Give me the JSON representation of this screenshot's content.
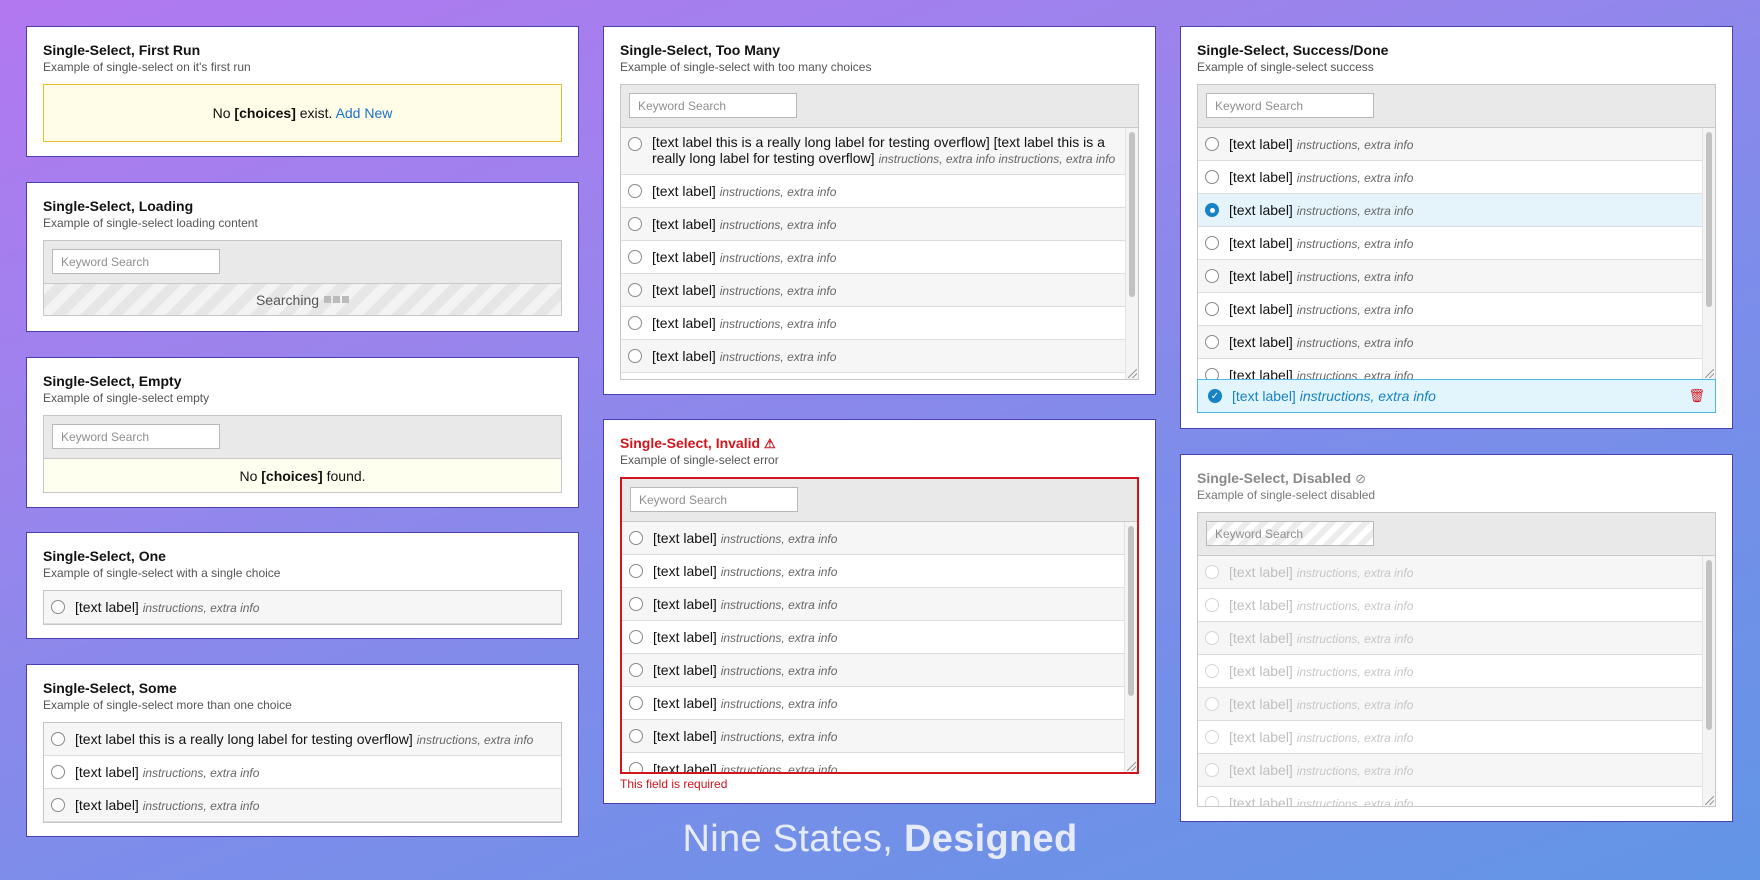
{
  "placeholder": "Keyword Search",
  "footer": {
    "light": "Nine States,",
    "bold": "Designed"
  },
  "first_run": {
    "title": "Single-Select, First Run",
    "subtitle": "Example of single-select on it's first run",
    "msg_pre": "No ",
    "msg_bold": "[choices]",
    "msg_post": " exist. ",
    "link": "Add New"
  },
  "loading": {
    "title": "Single-Select, Loading",
    "subtitle": "Example of single-select loading content",
    "status": "Searching"
  },
  "empty": {
    "title": "Single-Select, Empty",
    "subtitle": "Example of single-select empty",
    "msg_pre": "No ",
    "msg_bold": "[choices]",
    "msg_post": " found."
  },
  "one": {
    "title": "Single-Select, One",
    "subtitle": "Example of single-select with a single choice",
    "items": [
      {
        "label": "[text label]",
        "info": "instructions, extra info"
      }
    ]
  },
  "some": {
    "title": "Single-Select, Some",
    "subtitle": "Example of single-select more than one choice",
    "items": [
      {
        "label": "[text label this is a really long label for testing overflow]",
        "info": "instructions, extra info"
      },
      {
        "label": "[text label]",
        "info": "instructions, extra info"
      },
      {
        "label": "[text label]",
        "info": "instructions, extra info"
      }
    ]
  },
  "too_many": {
    "title": "Single-Select, Too Many",
    "subtitle": "Example of single-select with too many choices",
    "items": [
      {
        "label": "[text label this is a really long label for testing overflow] [text label this is a really long label for testing overflow]",
        "info": "instructions, extra info instructions, extra info"
      },
      {
        "label": "[text label]",
        "info": "instructions, extra info"
      },
      {
        "label": "[text label]",
        "info": "instructions, extra info"
      },
      {
        "label": "[text label]",
        "info": "instructions, extra info"
      },
      {
        "label": "[text label]",
        "info": "instructions, extra info"
      },
      {
        "label": "[text label]",
        "info": "instructions, extra info"
      },
      {
        "label": "[text label]",
        "info": "instructions, extra info"
      }
    ]
  },
  "invalid": {
    "title": "Single-Select, Invalid",
    "title_icon": "warning-icon",
    "subtitle": "Example of single-select error",
    "error": "This field is required",
    "items": [
      {
        "label": "[text label]",
        "info": "instructions, extra info"
      },
      {
        "label": "[text label]",
        "info": "instructions, extra info"
      },
      {
        "label": "[text label]",
        "info": "instructions, extra info"
      },
      {
        "label": "[text label]",
        "info": "instructions, extra info"
      },
      {
        "label": "[text label]",
        "info": "instructions, extra info"
      },
      {
        "label": "[text label]",
        "info": "instructions, extra info"
      },
      {
        "label": "[text label]",
        "info": "instructions, extra info"
      },
      {
        "label": "[text label]",
        "info": "instructions, extra info"
      }
    ]
  },
  "success": {
    "title": "Single-Select, Success/Done",
    "subtitle": "Example of single-select success",
    "selected_index": 2,
    "selected": {
      "label": "[text label]",
      "info": "instructions, extra info"
    },
    "items": [
      {
        "label": "[text label]",
        "info": "instructions, extra info"
      },
      {
        "label": "[text label]",
        "info": "instructions, extra info"
      },
      {
        "label": "[text label]",
        "info": "instructions, extra info"
      },
      {
        "label": "[text label]",
        "info": "instructions, extra info"
      },
      {
        "label": "[text label]",
        "info": "instructions, extra info"
      },
      {
        "label": "[text label]",
        "info": "instructions, extra info"
      },
      {
        "label": "[text label]",
        "info": "instructions, extra info"
      },
      {
        "label": "[text label]",
        "info": "instructions, extra info"
      }
    ]
  },
  "disabled": {
    "title": "Single-Select, Disabled",
    "title_icon": "disabled-icon",
    "subtitle": "Example of single-select disabled",
    "items": [
      {
        "label": "[text label]",
        "info": "instructions, extra info"
      },
      {
        "label": "[text label]",
        "info": "instructions, extra info"
      },
      {
        "label": "[text label]",
        "info": "instructions, extra info"
      },
      {
        "label": "[text label]",
        "info": "instructions, extra info"
      },
      {
        "label": "[text label]",
        "info": "instructions, extra info"
      },
      {
        "label": "[text label]",
        "info": "instructions, extra info"
      },
      {
        "label": "[text label]",
        "info": "instructions, extra info"
      },
      {
        "label": "[text label]",
        "info": "instructions, extra info"
      }
    ]
  }
}
